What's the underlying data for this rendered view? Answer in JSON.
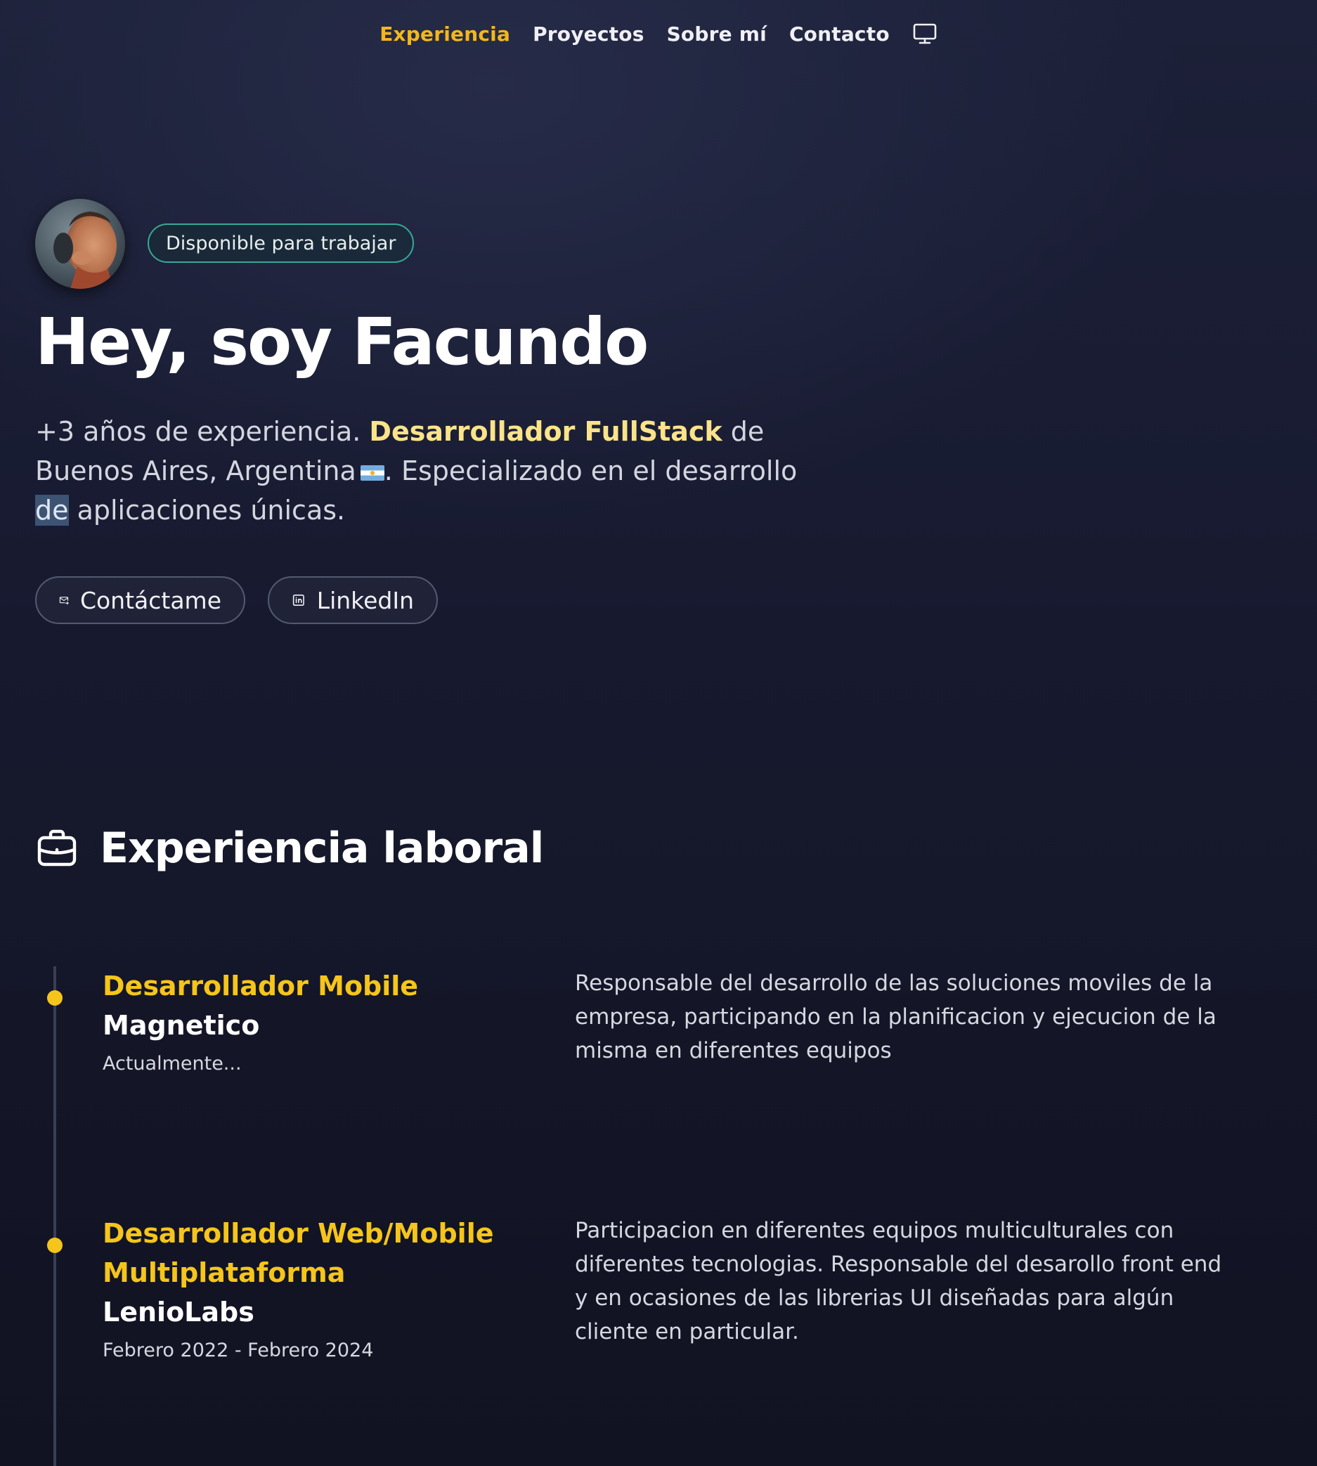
{
  "nav": {
    "items": [
      {
        "label": "Experiencia",
        "active": true
      },
      {
        "label": "Proyectos",
        "active": false
      },
      {
        "label": "Sobre mí",
        "active": false
      },
      {
        "label": "Contacto",
        "active": false
      }
    ],
    "theme_icon": "monitor-icon"
  },
  "hero": {
    "badge": "Disponible para trabajar",
    "title": "Hey, soy Facundo",
    "desc_part1": "+3 años de experiencia. ",
    "desc_highlight": "Desarrollador FullStack",
    "desc_part2": " de Buenos Aires, Argentina",
    "desc_part3": ". Especializado en el desarrollo ",
    "desc_selected": "de",
    "desc_part4": " aplicaciones únicas.",
    "buttons": {
      "contact": "Contáctame",
      "linkedin": "LinkedIn"
    }
  },
  "experience": {
    "title": "Experiencia laboral",
    "jobs": [
      {
        "role": "Desarrollador Mobile",
        "company": "Magnetico",
        "date": "Actualmente...",
        "description": "Responsable del desarrollo de las soluciones moviles de la empresa, participando en la planificacion y ejecucion de la misma en diferentes equipos"
      },
      {
        "role": "Desarrollador Web/Mobile Multiplataforma",
        "company": "LenioLabs",
        "date": "Febrero 2022 - Febrero 2024",
        "description": "Participacion en diferentes equipos multiculturales con diferentes tecnologias. Responsable del desarollo front end y en ocasiones de las librerias UI diseñadas para algún cliente en particular."
      }
    ]
  },
  "colors": {
    "accent": "#f6c51b",
    "nav_active": "#f2b71c",
    "highlight": "#fbe38a",
    "badge_border": "#38a898",
    "background": "#181b31"
  }
}
